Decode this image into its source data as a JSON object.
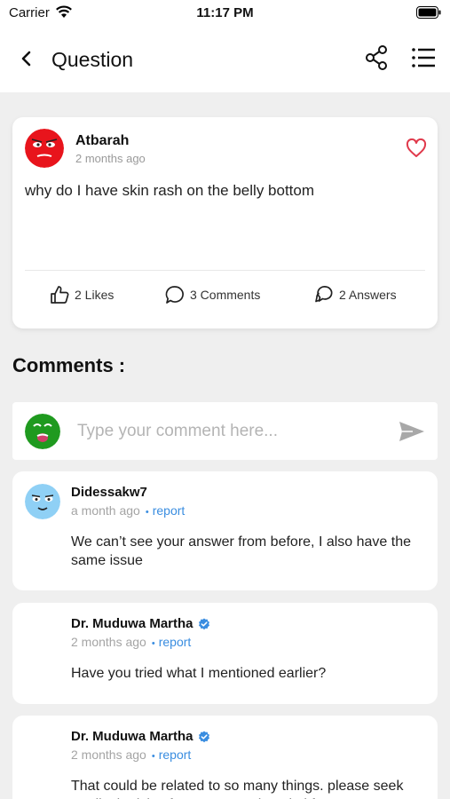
{
  "status_bar": {
    "carrier": "Carrier",
    "time": "11:17 PM"
  },
  "nav": {
    "title": "Question"
  },
  "question": {
    "author": "Atbarah",
    "time": "2 months ago",
    "text": "why do I have skin rash on the belly bottom",
    "likes_label": "2 Likes",
    "comments_label": "3 Comments",
    "answers_label": "2  Answers"
  },
  "comments_section": {
    "title": "Comments :"
  },
  "comment_input": {
    "placeholder": "Type your comment here..."
  },
  "comments": [
    {
      "author": "Didessakw7",
      "time": "a month ago",
      "report": "report",
      "text": "We can’t see your answer from before, I also have the same issue"
    },
    {
      "author": "Dr. Muduwa Martha",
      "time": "2 months ago",
      "report": "report",
      "text": "Have you tried what I mentioned earlier?"
    },
    {
      "author": "Dr. Muduwa Martha",
      "time": "2 months ago",
      "report": "report",
      "text": "That could be related to so many things. please seek medical advice from a proper hospital for a"
    }
  ],
  "colors": {
    "accent": "#3a8de0",
    "heart": "#e0394b",
    "avatar_red": "#e8141c",
    "avatar_green": "#1f9a1f",
    "avatar_blue": "#8fd0f5"
  }
}
